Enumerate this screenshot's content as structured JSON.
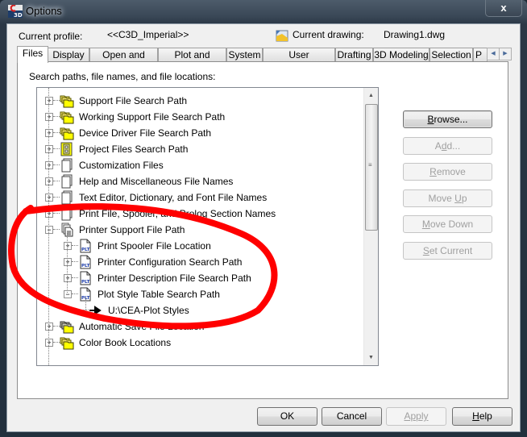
{
  "window": {
    "title": "Options",
    "close_label": "x",
    "app_icon": "civil3d-app-icon"
  },
  "header": {
    "current_profile_label": "Current profile:",
    "current_profile_value": "<<C3D_Imperial>>",
    "current_drawing_label": "Current drawing:",
    "current_drawing_value": "Drawing1.dwg",
    "drawing_icon": "drawing-file-icon"
  },
  "tabs": [
    {
      "label": "Files",
      "active": true
    },
    {
      "label": "Display"
    },
    {
      "label": "Open and Save"
    },
    {
      "label": "Plot and Publish"
    },
    {
      "label": "System"
    },
    {
      "label": "User Preferences"
    },
    {
      "label": "Drafting"
    },
    {
      "label": "3D Modeling"
    },
    {
      "label": "Selection"
    },
    {
      "label": "P"
    }
  ],
  "tab_scroll": {
    "left": "◀",
    "right": "▶"
  },
  "files_tab": {
    "section_label": "Search paths, file names, and file locations:",
    "tree": [
      {
        "label": "Support File Search Path",
        "icon": "folder-stack-icon",
        "expander": "+",
        "level": 0
      },
      {
        "label": "Working Support File Search Path",
        "icon": "folder-stack-icon",
        "expander": "+",
        "level": 0
      },
      {
        "label": "Device Driver File Search Path",
        "icon": "folder-stack-icon",
        "expander": "+",
        "level": 0
      },
      {
        "label": "Project Files Search Path",
        "icon": "project-files-icon",
        "expander": "+",
        "level": 0
      },
      {
        "label": "Customization Files",
        "icon": "file-stack-icon",
        "expander": "+",
        "level": 0
      },
      {
        "label": "Help and Miscellaneous File Names",
        "icon": "file-stack-icon",
        "expander": "+",
        "level": 0
      },
      {
        "label": "Text Editor, Dictionary, and Font File Names",
        "icon": "file-stack-icon",
        "expander": "+",
        "level": 0
      },
      {
        "label": "Print File, Spooler, and Prolog Section Names",
        "icon": "file-stack-icon",
        "expander": "+",
        "level": 0
      },
      {
        "label": "Printer Support File Path",
        "icon": "printer-support-icon",
        "expander": "−",
        "level": 0
      },
      {
        "label": "Print Spooler File Location",
        "icon": "plt-file-icon",
        "expander": "+",
        "level": 1
      },
      {
        "label": "Printer Configuration Search Path",
        "icon": "plt-file-icon",
        "expander": "+",
        "level": 1
      },
      {
        "label": "Printer Description File Search Path",
        "icon": "plt-file-icon",
        "expander": "+",
        "level": 1
      },
      {
        "label": "Plot Style Table Search Path",
        "icon": "plt-file-icon",
        "expander": "−",
        "level": 1
      },
      {
        "label": "U:\\CEA-Plot Styles",
        "icon": "path-arrow-icon",
        "expander": "",
        "level": 2
      },
      {
        "label": "Automatic Save File Location",
        "icon": "folder-stack-dark-icon",
        "expander": "+",
        "level": 0
      },
      {
        "label": "Color Book Locations",
        "icon": "folder-stack-icon",
        "expander": "+",
        "level": 0
      }
    ],
    "side_buttons": [
      {
        "label": "Browse...",
        "mnemonic": "B",
        "enabled": true
      },
      {
        "label": "Add...",
        "mnemonic": "d",
        "enabled": false
      },
      {
        "label": "Remove",
        "mnemonic": "R",
        "enabled": false
      },
      {
        "label": "Move Up",
        "mnemonic": "U",
        "enabled": false
      },
      {
        "label": "Move Down",
        "mnemonic": "M",
        "enabled": false
      },
      {
        "label": "Set Current",
        "mnemonic": "S",
        "enabled": false
      }
    ]
  },
  "footer": {
    "ok_label": "OK",
    "cancel_label": "Cancel",
    "apply_label": "Apply",
    "help_label": "Help"
  },
  "annotation": {
    "color": "#ff0000",
    "shape": "hand-drawn ellipse around Printer Support File Path"
  }
}
